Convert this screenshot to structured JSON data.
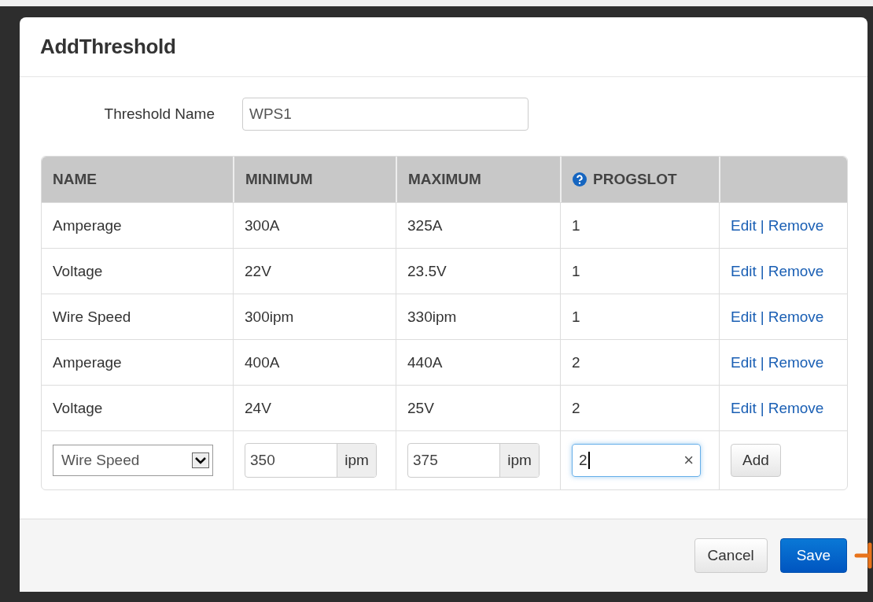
{
  "dialog": {
    "title": "AddThreshold"
  },
  "threshold_name": {
    "label": "Threshold Name",
    "value": "WPS1"
  },
  "table": {
    "columns": [
      {
        "label": "NAME",
        "kind": "plain"
      },
      {
        "label": "MINIMUM",
        "kind": "plain"
      },
      {
        "label": "MAXIMUM",
        "kind": "plain"
      },
      {
        "label": "PROGSLOT",
        "kind": "help"
      },
      {
        "kind": "plain"
      }
    ],
    "rows": [
      {
        "name": "Amperage",
        "minimum": "300A",
        "maximum": "325A",
        "progslot": "1",
        "actions": [
          "Edit",
          "|",
          "Remove"
        ]
      },
      {
        "name": "Voltage",
        "minimum": "22V",
        "maximum": "23.5V",
        "progslot": "1",
        "actions": [
          "Edit",
          "|",
          "Remove"
        ]
      },
      {
        "name": "Wire Speed",
        "minimum": "300ipm",
        "maximum": "330ipm",
        "progslot": "1",
        "actions": [
          "Edit",
          "|",
          "Remove"
        ]
      },
      {
        "name": "Amperage",
        "minimum": "400A",
        "maximum": "440A",
        "progslot": "2",
        "actions": [
          "Edit",
          "|",
          "Remove"
        ]
      },
      {
        "name": "Voltage",
        "minimum": "24V",
        "maximum": "25V",
        "progslot": "2",
        "actions": [
          "Edit",
          "|",
          "Remove"
        ]
      }
    ],
    "new_row": {
      "name": "Wire Speed",
      "minimum": "350",
      "minimum_unit": "ipm",
      "maximum": "375",
      "maximum_unit": "ipm",
      "progslot": "2",
      "progslot_focused": true,
      "clear": "×",
      "add_button": "Add"
    }
  },
  "buttons": [
    {
      "label": "Cancel",
      "kind": "default"
    },
    {
      "label": "Save",
      "kind": "primary"
    }
  ]
}
